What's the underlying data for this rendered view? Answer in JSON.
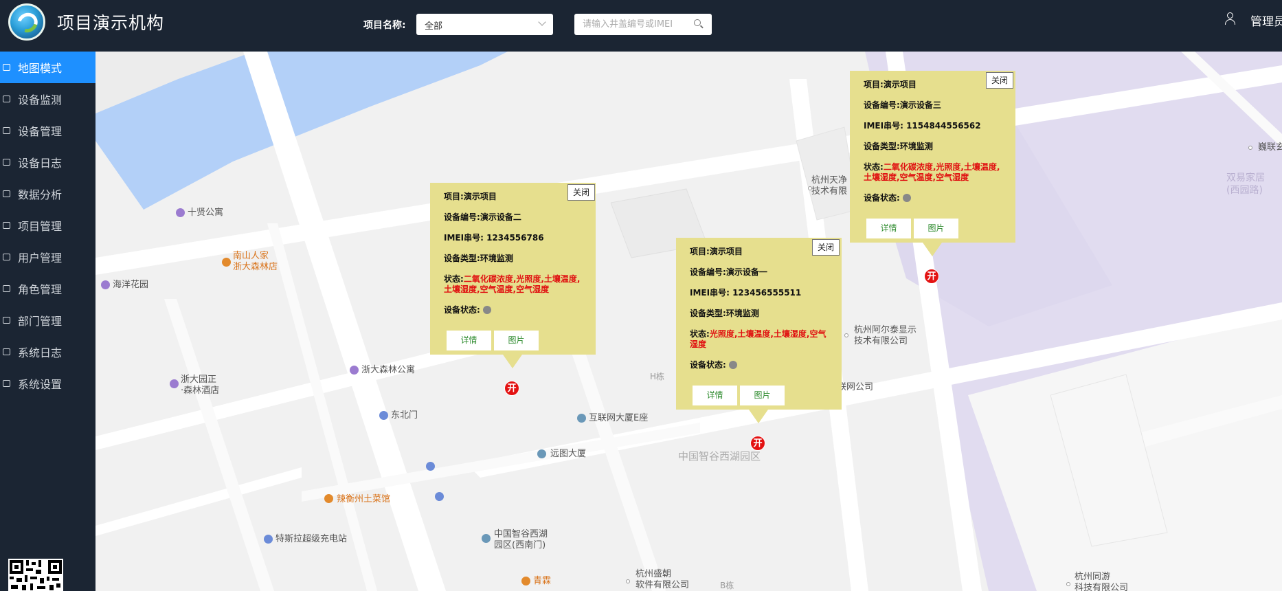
{
  "header": {
    "title": "项目演示机构",
    "project_label": "项目名称:",
    "project_select_value": "全部",
    "search_placeholder": "请输入井盖编号或IMEI",
    "user_name": "管理员"
  },
  "sidebar": {
    "items": [
      {
        "label": "地图模式",
        "active": true
      },
      {
        "label": "设备监测"
      },
      {
        "label": "设备管理"
      },
      {
        "label": "设备日志"
      },
      {
        "label": "数据分析"
      },
      {
        "label": "项目管理"
      },
      {
        "label": "用户管理"
      },
      {
        "label": "角色管理"
      },
      {
        "label": "部门管理"
      },
      {
        "label": "系统日志"
      },
      {
        "label": "系统设置"
      }
    ]
  },
  "map": {
    "labels": {
      "shixian": "十贤公寓",
      "haiyang": "海洋花园",
      "nanshan1": "南山人家",
      "nanshan2": "浙大森林店",
      "senlin_apt": "浙大森林公寓",
      "yuanzheng1": "浙大园正",
      "yuanzheng2": "·森林酒店",
      "dongbeimen": "东北门",
      "hulianwang": "互联网大厦E座",
      "yuantu": "远图大厦",
      "laheng": "辣衡州土菜馆",
      "tesla": "特斯拉超级充电站",
      "zhigu_ximen1": "中国智谷西湖",
      "zhigu_ximen2": "园区(西南门)",
      "qinglin": "青霖",
      "shengchao1": "杭州盛朝",
      "shengchao2": "软件有限公司",
      "b_dong": "B栋",
      "h_dong": "H栋",
      "zhigu_park": "中国智谷西湖园区",
      "alta1": "杭州阿尔泰显示",
      "alta2": "技术有限公司",
      "lianwang": "联网公司",
      "tianjing1": "杭州天净",
      "tianjing2": "技术有限",
      "tongyou1": "杭州同游",
      "tongyou2": "科技有限公司",
      "shuangyi1": "双易家居",
      "shuangyi2": "(西园路)",
      "jinglian": "巍联玄"
    }
  },
  "popups": [
    {
      "project_label": "项目:",
      "project": "演示项目",
      "code_label": "设备编号:",
      "code": "演示设备二",
      "imei_label": "IMEI串号:",
      "imei": "1234556786",
      "type_label": "设备类型:",
      "type": "环境监测",
      "state_label": "状态:",
      "state": "二氧化碳浓度,光照度,土壤温度,土壤湿度,空气温度,空气湿度",
      "dev_state_label": "设备状态:",
      "close": "关闭",
      "detail": "详情",
      "photo": "图片",
      "marker": "开"
    },
    {
      "project_label": "项目:",
      "project": "演示项目",
      "code_label": "设备编号:",
      "code": "演示设备一",
      "imei_label": "IMEI串号:",
      "imei": "123456555511",
      "type_label": "设备类型:",
      "type": "环境监测",
      "state_label": "状态:",
      "state": "光照度,土壤温度,土壤湿度,空气湿度",
      "dev_state_label": "设备状态:",
      "close": "关闭",
      "detail": "详情",
      "photo": "图片",
      "marker": "开"
    },
    {
      "project_label": "项目:",
      "project": "演示项目",
      "code_label": "设备编号:",
      "code": "演示设备三",
      "imei_label": "IMEI串号:",
      "imei": "1154844556562",
      "type_label": "设备类型:",
      "type": "环境监测",
      "state_label": "状态:",
      "state": "二氧化碳浓度,光照度,土壤温度,土壤湿度,空气温度,空气湿度",
      "dev_state_label": "设备状态:",
      "close": "关闭",
      "detail": "详情",
      "photo": "图片",
      "marker": "开"
    }
  ],
  "colors": {
    "header_bg": "#1b2533",
    "active_nav": "#1e90ff",
    "popup_bg": "#e6df8e",
    "status_red": "#e01010",
    "marker_red": "#e31212",
    "button_text": "#2e8b2e"
  }
}
